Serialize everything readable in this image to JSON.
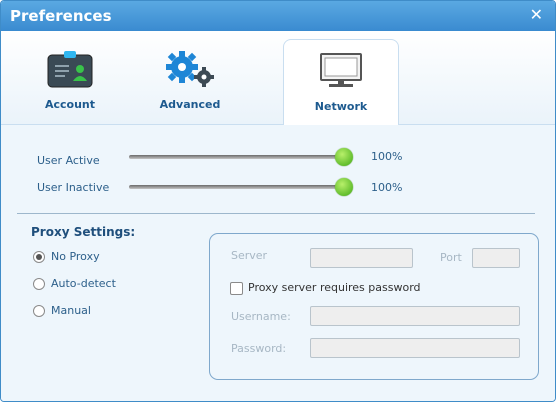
{
  "window": {
    "title": "Preferences"
  },
  "tabs": [
    {
      "label": "Account"
    },
    {
      "label": "Advanced"
    },
    {
      "label": "Network",
      "active": true
    }
  ],
  "sliders": {
    "user_active": {
      "label": "User Active",
      "value_text": "100%",
      "value": 1.0
    },
    "user_inactive": {
      "label": "User Inactive",
      "value_text": "100%",
      "value": 1.0
    }
  },
  "proxy": {
    "title": "Proxy Settings:",
    "options": [
      "No Proxy",
      "Auto-detect",
      "Manual"
    ],
    "selected": "No Proxy",
    "server_label": "Server",
    "port_label": "Port",
    "requires_password_label": "Proxy server requires password",
    "username_label": "Username:",
    "password_label": "Password:",
    "server_value": "",
    "port_value": "",
    "username_value": "",
    "password_value": ""
  },
  "colors": {
    "titlebar": "#4a9bd9",
    "accent": "#1d5a8f",
    "slider_thumb": "#5cc420"
  }
}
